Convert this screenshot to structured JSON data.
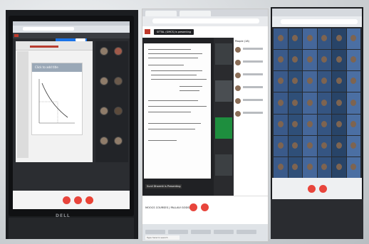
{
  "scene": {
    "description_tags": [
      "three-photos",
      "video-conference",
      "screens"
    ],
    "colors": {
      "meet_red": "#e8453c",
      "brand_red": "#c0392b",
      "accent_blue": "#1a73e8"
    }
  },
  "left_photo": {
    "slide_heading": "Click to add title",
    "device_brand": "DELL"
  },
  "middle_photo": {
    "presenting_chip": "SITTAL (GMCS) is presenting",
    "caption": "Sunil Dharmit is Presenting",
    "meeting_name": "MOOCS COURSES | PALLAVI GODSE...",
    "taskbar_search": "Type here to search",
    "people_header": "People (18)",
    "people": [
      "MOOCS COURSES",
      "Shravi Aurat Katari",
      "Khushi...",
      "Shruti Sharma",
      "Saloni..."
    ]
  },
  "right_photo": {
    "gallery_rows": 7,
    "gallery_cols": 6
  }
}
